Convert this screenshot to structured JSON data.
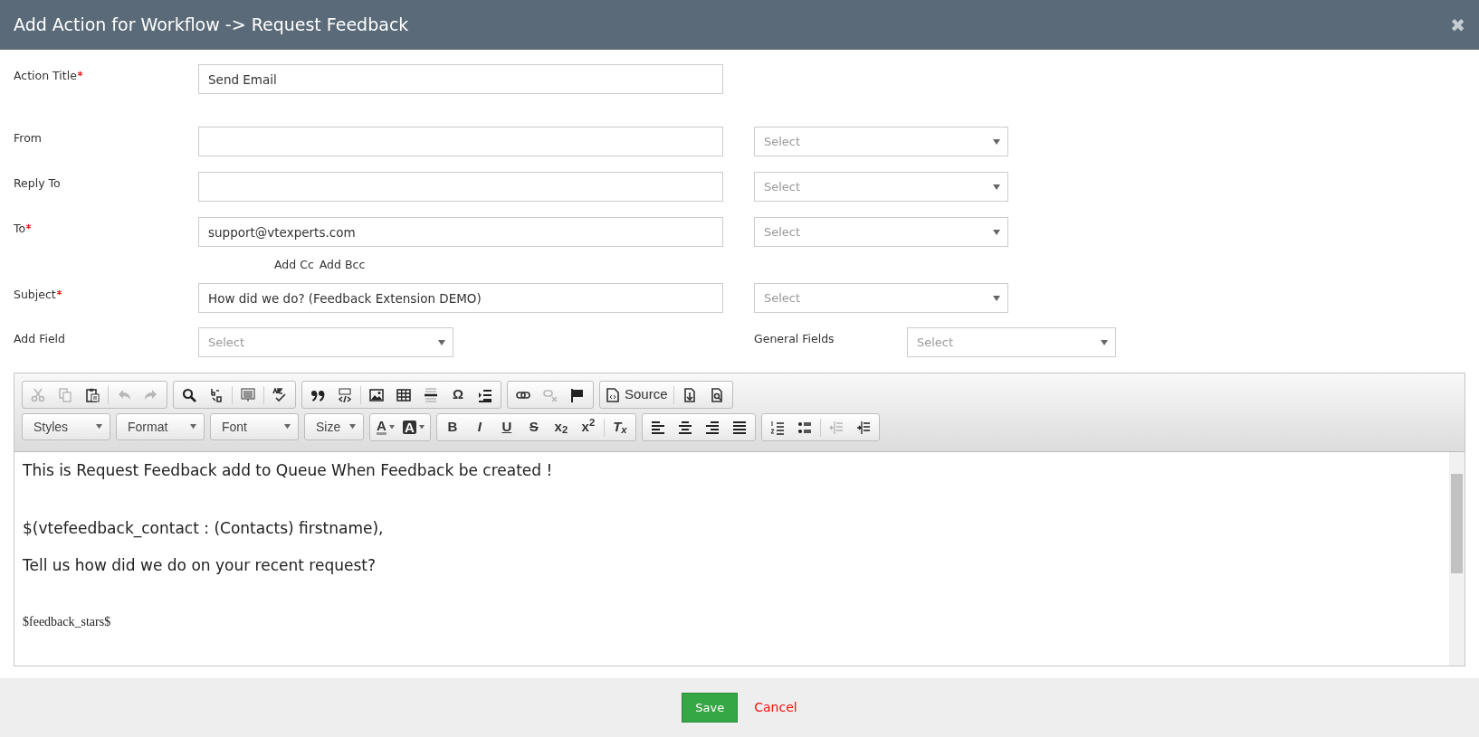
{
  "window": {
    "title": "Add Action for Workflow -> Request Feedback",
    "close": "✖"
  },
  "form": {
    "rows": [
      {
        "label": "Action Title",
        "required": true,
        "value": "Send Email",
        "select": null
      },
      {
        "label": "From",
        "required": false,
        "value": "",
        "select": "Select"
      },
      {
        "label": "Reply To",
        "required": false,
        "value": "",
        "select": "Select"
      },
      {
        "label": "To",
        "required": true,
        "value": "support@vtexperts.com",
        "select": "Select"
      }
    ],
    "cc_links": [
      "Add Cc",
      "Add Bcc"
    ],
    "subject": {
      "label": "Subject",
      "required": true,
      "value": "How did we do? (Feedback Extension DEMO)",
      "select": "Select"
    },
    "add_field": {
      "label": "Add Field",
      "placeholder": "Select"
    },
    "general_fields": {
      "label": "General Fields",
      "placeholder": "Select"
    }
  },
  "toolbar": {
    "row_1": [
      [
        {
          "kind": "icon",
          "disabled": true
        },
        {
          "kind": "icon",
          "disabled": true
        },
        {
          "kind": "icon",
          "disabled": false
        },
        {
          "kind": "sep"
        },
        {
          "kind": "icon",
          "disabled": true
        },
        {
          "kind": "icon",
          "disabled": true
        }
      ],
      [
        {
          "kind": "icon",
          "disabled": false
        },
        {
          "kind": "icon",
          "disabled": false
        },
        {
          "kind": "sep"
        },
        {
          "kind": "icon",
          "disabled": false
        },
        {
          "kind": "sep"
        },
        {
          "kind": "icon",
          "disabled": false
        }
      ],
      [
        {
          "kind": "icon",
          "disabled": false
        },
        {
          "kind": "icon",
          "disabled": false
        },
        {
          "kind": "sep"
        },
        {
          "kind": "icon",
          "disabled": false
        },
        {
          "kind": "icon",
          "disabled": false
        },
        {
          "kind": "icon",
          "disabled": false
        },
        {
          "kind": "glyph",
          "text": "Ω",
          "disabled": false
        },
        {
          "kind": "icon",
          "disabled": false
        }
      ],
      [
        {
          "kind": "icon",
          "disabled": false
        },
        {
          "kind": "icon",
          "disabled": true
        },
        {
          "kind": "icon",
          "disabled": false
        }
      ],
      [
        {
          "kind": "text",
          "text": "Source",
          "disabled": false
        },
        {
          "kind": "sep"
        },
        {
          "kind": "icon",
          "disabled": false
        },
        {
          "kind": "icon",
          "disabled": false
        }
      ]
    ],
    "dropdowns": [
      "Styles",
      "Format",
      "Font",
      "Size"
    ],
    "row_2": [
      [
        {
          "kind": "color",
          "text": "A",
          "disabled": false
        },
        {
          "kind": "color-bg",
          "text": "A",
          "disabled": false
        }
      ],
      [
        {
          "kind": "glyph",
          "text": "B",
          "disabled": false
        },
        {
          "kind": "glyph",
          "text": "I",
          "disabled": false
        },
        {
          "kind": "glyph",
          "text": "U",
          "disabled": false
        },
        {
          "kind": "glyph",
          "text": "S",
          "disabled": false
        },
        {
          "kind": "glyph",
          "text": "x$_{2}$",
          "disabled": false
        },
        {
          "kind": "glyph",
          "text": "x$^{2}$",
          "disabled": false
        },
        {
          "kind": "sep"
        },
        {
          "kind": "glyph",
          "text": "T$_{x}$",
          "disabled": false
        }
      ],
      [
        {
          "kind": "icon",
          "disabled": false
        },
        {
          "kind": "icon",
          "disabled": false
        },
        {
          "kind": "icon",
          "disabled": false
        },
        {
          "kind": "icon",
          "disabled": false
        }
      ],
      [
        {
          "kind": "icon",
          "disabled": false
        },
        {
          "kind": "icon",
          "disabled": false
        },
        {
          "kind": "sep"
        },
        {
          "kind": "icon",
          "disabled": true
        },
        {
          "kind": "icon",
          "disabled": false
        }
      ]
    ]
  },
  "editor": {
    "lines": [
      {
        "kind": "sans",
        "text": "This is Request Feedback add to Queue When Feedback be created !"
      },
      {
        "kind": "sans",
        "text": "$(vtefeedback_contact : (Contacts) firstname),"
      },
      {
        "kind": "sans",
        "text": "Tell us how did we do on your recent request?"
      },
      {
        "kind": "serif",
        "text": "$feedback_stars$"
      }
    ]
  },
  "footer": {
    "save": "Save",
    "cancel": "Cancel"
  }
}
